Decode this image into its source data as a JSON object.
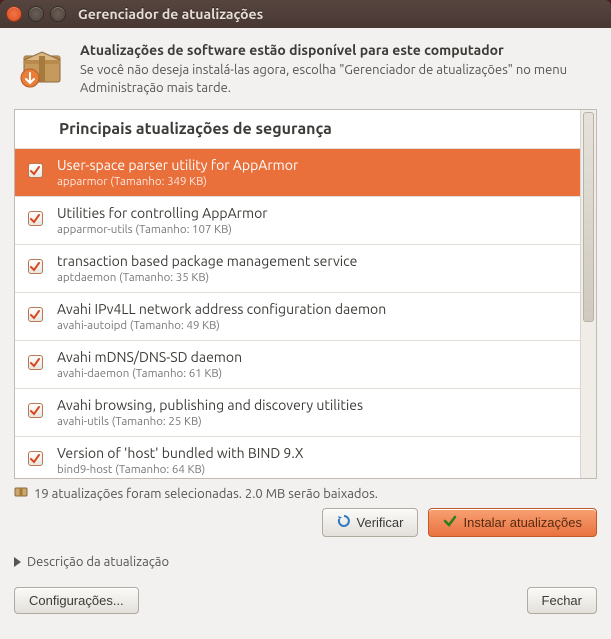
{
  "window": {
    "title": "Gerenciador de atualizações"
  },
  "header": {
    "heading": "Atualizações de software estão disponível para este computador",
    "subtext": "Se você não deseja instalá-las agora, escolha \"Gerenciador de atualizações\" no menu Administração mais tarde."
  },
  "section_title": "Principais atualizações de segurança",
  "updates": [
    {
      "title": "User-space parser utility for AppArmor",
      "pkg": "apparmor",
      "size": "349 KB",
      "selected": true
    },
    {
      "title": "Utilities for controlling AppArmor",
      "pkg": "apparmor-utils",
      "size": "107 KB",
      "selected": false
    },
    {
      "title": "transaction based package management service",
      "pkg": "aptdaemon",
      "size": "35 KB",
      "selected": false
    },
    {
      "title": "Avahi IPv4LL network address configuration daemon",
      "pkg": "avahi-autoipd",
      "size": "49 KB",
      "selected": false
    },
    {
      "title": "Avahi mDNS/DNS-SD daemon",
      "pkg": "avahi-daemon",
      "size": "61 KB",
      "selected": false
    },
    {
      "title": "Avahi browsing, publishing and discovery utilities",
      "pkg": "avahi-utils",
      "size": "25 KB",
      "selected": false
    },
    {
      "title": "Version of 'host' bundled with BIND 9.X",
      "pkg": "bind9-host",
      "size": "64 KB",
      "selected": false
    }
  ],
  "size_label_prefix": "Tamanho: ",
  "status": "19 atualizações foram selecionadas. 2.0 MB serão baixados.",
  "buttons": {
    "check": "Verificar",
    "install": "Instalar atualizações",
    "settings": "Configurações...",
    "close": "Fechar"
  },
  "expander": "Descrição da atualização",
  "colors": {
    "accent": "#e96f3b"
  }
}
